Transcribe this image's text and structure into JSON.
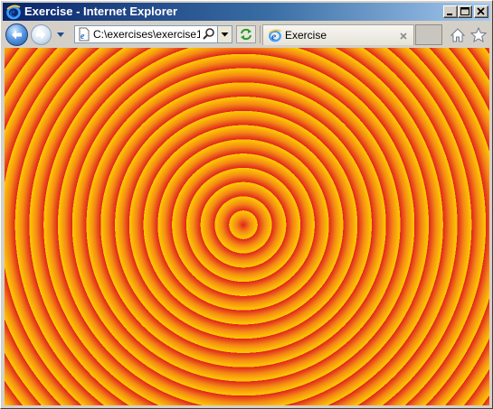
{
  "window": {
    "title": "Exercise - Internet Explorer"
  },
  "address": {
    "url": "C:\\exercises\\exercise1."
  },
  "tab": {
    "label": "Exercise"
  },
  "icons": {
    "title": "ie-icon",
    "back": "back-arrow-icon",
    "forward": "forward-arrow-icon",
    "search": "search-icon",
    "refresh": "refresh-icon",
    "home": "home-icon",
    "favorites": "star-icon",
    "close": "close-icon"
  },
  "colors": {
    "title_gradient_start": "#0a246a",
    "title_gradient_end": "#a6caf0",
    "ring_red": "#e0231e",
    "ring_orange": "#f58a14",
    "ring_yellow": "#ffcc00"
  },
  "page": {
    "pattern": "concentric-rings",
    "ring_count": 21
  }
}
